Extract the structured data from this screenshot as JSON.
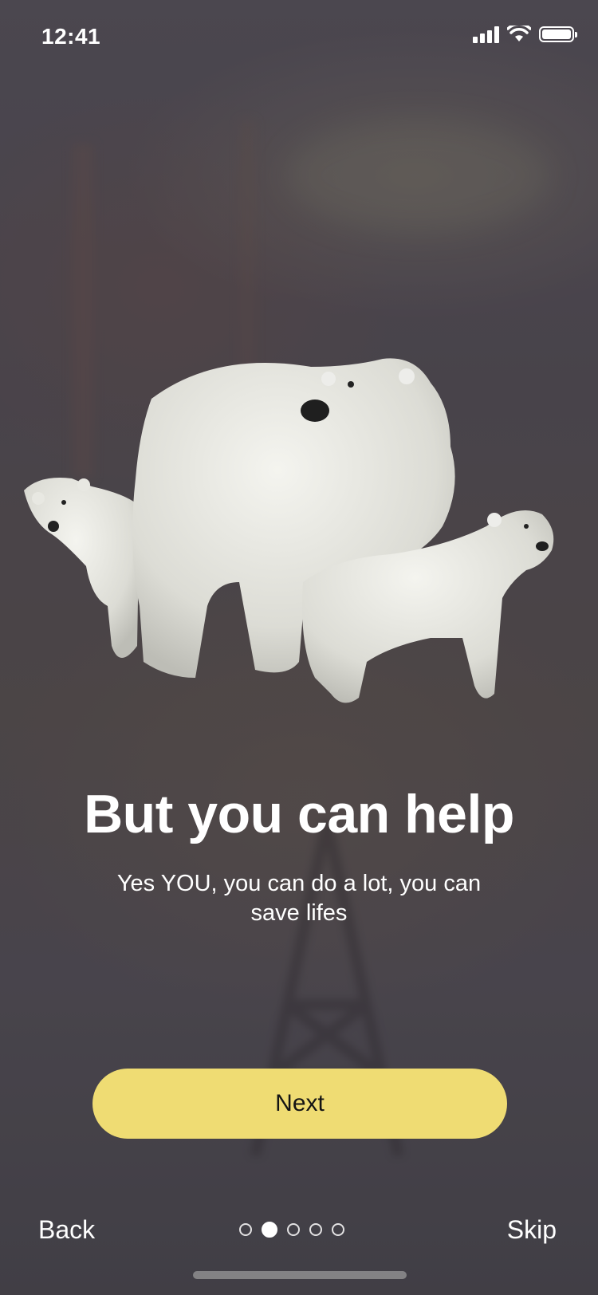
{
  "status_bar": {
    "time": "12:41"
  },
  "onboarding": {
    "title": "But you can help",
    "subtitle": "Yes YOU, you can do a lot, you can save lifes",
    "next_label": "Next",
    "back_label": "Back",
    "skip_label": "Skip",
    "pager": {
      "total": 5,
      "current_index": 1
    }
  },
  "colors": {
    "primary_button": "#efdc73",
    "text": "#ffffff"
  }
}
